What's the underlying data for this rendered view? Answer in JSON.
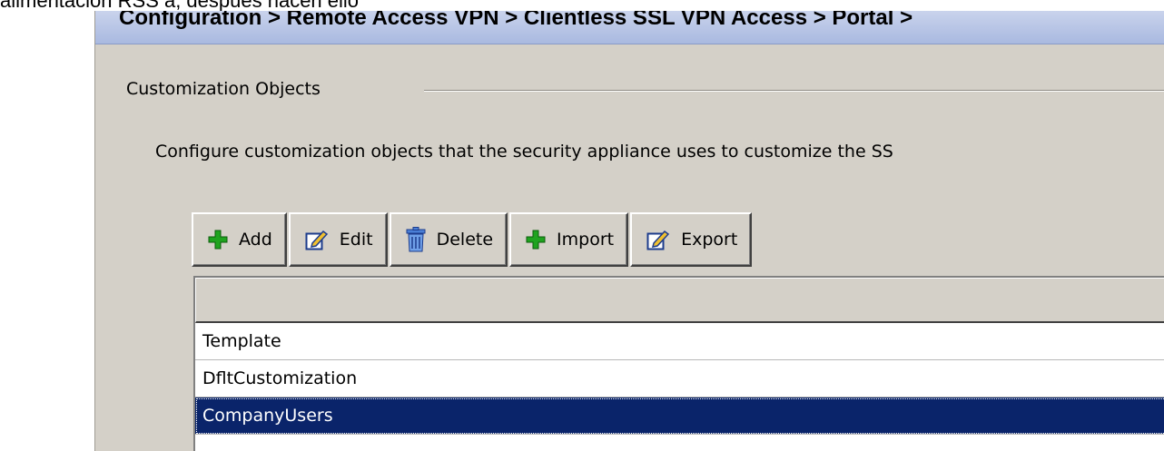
{
  "page": {
    "caption": "alimentación RSS a, después hacen ello"
  },
  "breadcrumb": {
    "text": "Configuration > Remote Access VPN > Clientless SSL VPN Access > Portal >"
  },
  "group": {
    "legend": "Customization Objects",
    "description": "Configure customization objects that the security appliance uses to customize the SS"
  },
  "toolbar": {
    "buttons": [
      {
        "label": "Add",
        "icon": "plus-icon"
      },
      {
        "label": "Edit",
        "icon": "edit-icon"
      },
      {
        "label": "Delete",
        "icon": "trash-icon"
      },
      {
        "label": "Import",
        "icon": "plus-icon"
      },
      {
        "label": "Export",
        "icon": "edit-icon"
      }
    ]
  },
  "table": {
    "header": "",
    "rows": [
      "Template",
      "DfltCustomization",
      "CompanyUsers"
    ],
    "selected_index": 2
  },
  "colors": {
    "breadcrumb_bg": "#b4c3e6",
    "window_bg": "#d4d0c8",
    "selection": "#0a246a",
    "add_icon": "#1fa31f"
  }
}
